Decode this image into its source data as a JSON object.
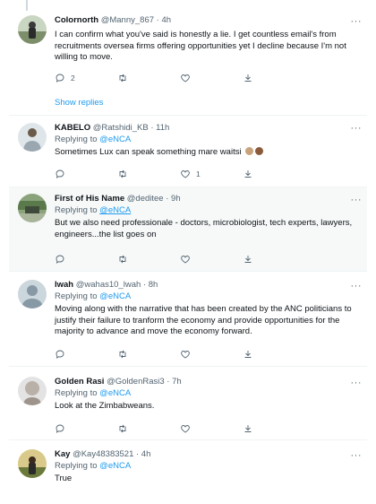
{
  "show_replies_label": "Show replies",
  "icons": {
    "reply": "reply-icon",
    "retweet": "retweet-icon",
    "like": "heart-icon",
    "share": "share-icon",
    "more": "more-icon"
  },
  "colors": {
    "link": "#1d9bf0",
    "secondary": "#536471",
    "highlight_bg": "#f7f9f9"
  },
  "tweets": [
    {
      "name": "Colornorth",
      "handle": "@Manny_867",
      "time": "· 4h",
      "reply_prefix": "",
      "reply_handle": "",
      "text": "I can confirm what you've said is honestly a lie. I get countless email's from recruitments oversea firms offering opportunities yet I decline because I'm not willing to move.",
      "replies": "2",
      "retweets": "",
      "likes": ""
    },
    {
      "name": "KABELO",
      "handle": "@Ratshidi_KB",
      "time": "· 11h",
      "reply_prefix": "Replying to ",
      "reply_handle": "@eNCA",
      "text": "Sometimes Lux can speak something mare waitsi",
      "replies": "",
      "retweets": "",
      "likes": "1"
    },
    {
      "name": "First of His Name",
      "handle": "@deditee",
      "time": "· 9h",
      "reply_prefix": "Replying to ",
      "reply_handle": "@eNCA",
      "text": "But we also need professionale - doctors, microbiologist, tech experts, lawyers, engineers...the list goes on",
      "replies": "",
      "retweets": "",
      "likes": ""
    },
    {
      "name": "lwah",
      "handle": "@wahas10_lwah",
      "time": "· 8h",
      "reply_prefix": "Replying to ",
      "reply_handle": "@eNCA",
      "text": "Moving along with the narrative that has been created by the ANC politicians to justify their failure to tranform the economy and provide opportunities for the majority to advance and move the economy forward.",
      "replies": "",
      "retweets": "",
      "likes": ""
    },
    {
      "name": "Golden Rasi",
      "handle": "@GoldenRasi3",
      "time": "· 7h",
      "reply_prefix": "Replying to ",
      "reply_handle": "@eNCA",
      "text": "Look at the Zimbabweans.",
      "replies": "",
      "retweets": "",
      "likes": ""
    },
    {
      "name": "Kay",
      "handle": "@Kay48383521",
      "time": "· 4h",
      "reply_prefix": "Replying to ",
      "reply_handle": "@eNCA",
      "text": "True",
      "replies": "",
      "retweets": "",
      "likes": ""
    }
  ]
}
